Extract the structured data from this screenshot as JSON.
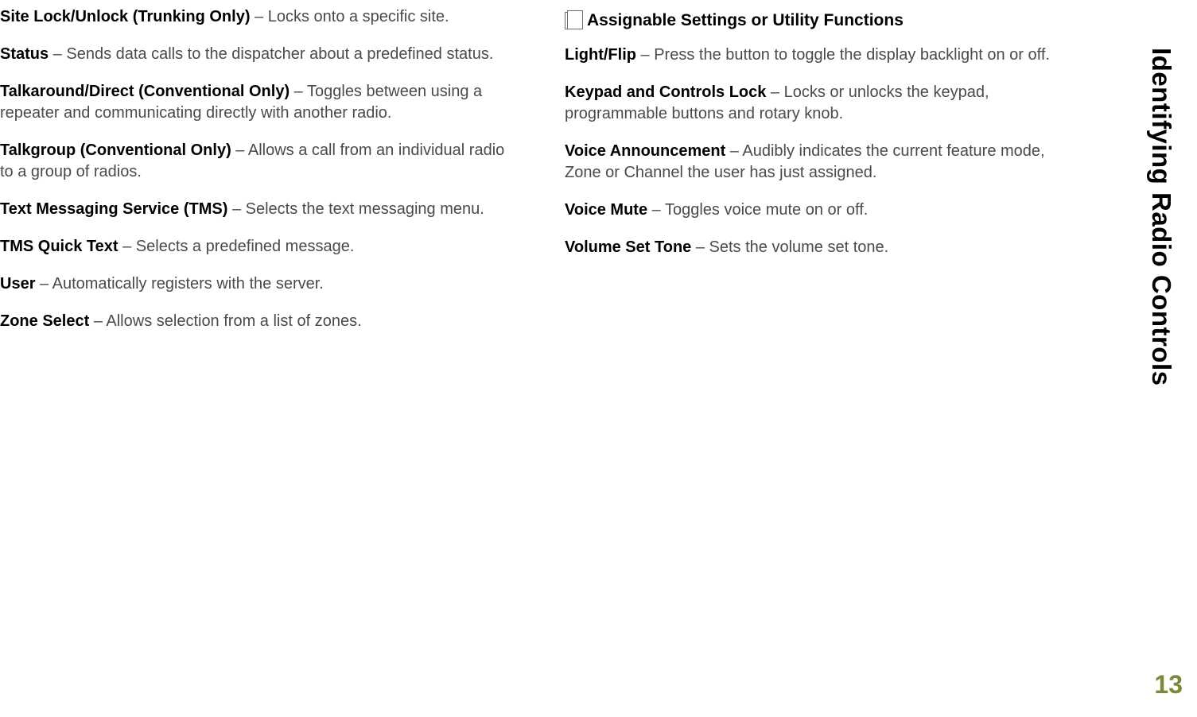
{
  "side_title": "Identifying Radio Controls",
  "page_number": "13",
  "left": [
    {
      "term": "Site Lock/Unlock (Trunking Only)",
      "desc": " – Locks onto a specific site."
    },
    {
      "term": "Status",
      "desc": " – Sends data calls to the dispatcher about a predefined status."
    },
    {
      "term": "Talkaround/Direct (Conventional Only)",
      "desc": " – Toggles between using a repeater and communicating directly with another radio."
    },
    {
      "term": "Talkgroup (Conventional Only)",
      "desc": " – Allows a call from an individual radio to a group of radios."
    },
    {
      "term": "Text Messaging Service (TMS)",
      "desc": " – Selects the text messaging menu."
    },
    {
      "term": "TMS Quick Text",
      "desc": " – Selects a predefined message."
    },
    {
      "term": "User",
      "desc": " – Automatically registers with the server."
    },
    {
      "term": "Zone Select",
      "desc": " – Allows selection from a list of zones."
    }
  ],
  "right_heading": "Assignable Settings or Utility Functions",
  "right": [
    {
      "term": "Light/Flip",
      "desc": " – Press the button to toggle the display backlight on or off."
    },
    {
      "term": "Keypad and Controls Lock",
      "desc": " – Locks or unlocks the keypad, programmable buttons and rotary knob."
    },
    {
      "term": "Voice Announcement",
      "desc": " – Audibly indicates the current feature mode, Zone or Channel the user has just assigned."
    },
    {
      "term": "Voice Mute",
      "desc": " – Toggles voice mute on or off."
    },
    {
      "term": "Volume Set Tone",
      "desc": " – Sets the volume set tone."
    }
  ]
}
